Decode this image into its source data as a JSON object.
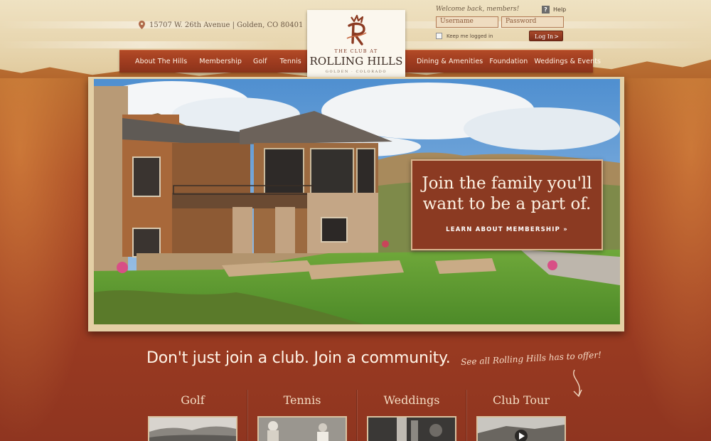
{
  "header": {
    "address": "15707 W. 26th Avenue | Golden, CO 80401",
    "welcome": "Welcome back, members!",
    "help_label": "Help",
    "username_placeholder": "Username",
    "password_placeholder": "Password",
    "keep_logged_in": "Keep me logged in",
    "login_label": "Log In",
    "login_arrow": ">"
  },
  "logo": {
    "club_at": "THE CLUB AT",
    "name": "ROLLING HILLS",
    "location": "GOLDEN · COLORADO"
  },
  "nav_left": [
    "About The Hills",
    "Membership",
    "Golf",
    "Tennis"
  ],
  "nav_right": [
    "Dining & Amenities",
    "Foundation",
    "Weddings & Events"
  ],
  "hero": {
    "callout_title": "Join the family you'll want to be a part of.",
    "callout_link": "LEARN ABOUT MEMBERSHIP »"
  },
  "main": {
    "tagline": "Don't just join a club. Join a community.",
    "see_all": "See all Rolling Hills has to offer!"
  },
  "features": [
    {
      "title": "Golf"
    },
    {
      "title": "Tennis"
    },
    {
      "title": "Weddings"
    },
    {
      "title": "Club Tour"
    }
  ],
  "colors": {
    "accent": "#9d3b1f",
    "background": "#a84b25",
    "paper": "#efe2c2"
  }
}
